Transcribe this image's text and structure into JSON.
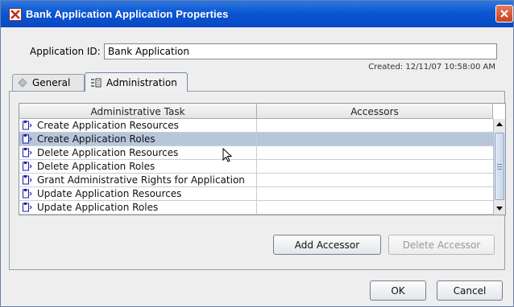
{
  "window": {
    "title": "Bank Application Application Properties"
  },
  "form": {
    "app_id_label": "Application ID:",
    "app_id_value": "Bank Application",
    "created": "Created: 12/11/07 10:58:00 AM"
  },
  "tabs": [
    {
      "label": "General",
      "selected": false
    },
    {
      "label": "Administration",
      "selected": true
    }
  ],
  "table": {
    "columns": [
      "Administrative Task",
      "Accessors"
    ],
    "rows": [
      {
        "task": "Create Application Resources",
        "accessors": "",
        "selected": false
      },
      {
        "task": "Create Application Roles",
        "accessors": "",
        "selected": true
      },
      {
        "task": "Delete Application Resources",
        "accessors": "",
        "selected": false
      },
      {
        "task": "Delete Application Roles",
        "accessors": "",
        "selected": false
      },
      {
        "task": "Grant Administrative Rights for Application",
        "accessors": "",
        "selected": false
      },
      {
        "task": "Update Application Resources",
        "accessors": "",
        "selected": false
      },
      {
        "task": "Update Application Roles",
        "accessors": "",
        "selected": false
      }
    ]
  },
  "buttons": {
    "add_accessor": "Add Accessor",
    "delete_accessor": "Delete Accessor",
    "ok": "OK",
    "cancel": "Cancel"
  },
  "colors": {
    "titlebar": "#0b56d2",
    "selection": "#b8c6db"
  },
  "icons": {
    "app": "app-x-icon",
    "close": "close-icon",
    "general_tab": "general-tab-icon",
    "admin_tab": "admin-tab-icon",
    "row": "task-icon"
  }
}
